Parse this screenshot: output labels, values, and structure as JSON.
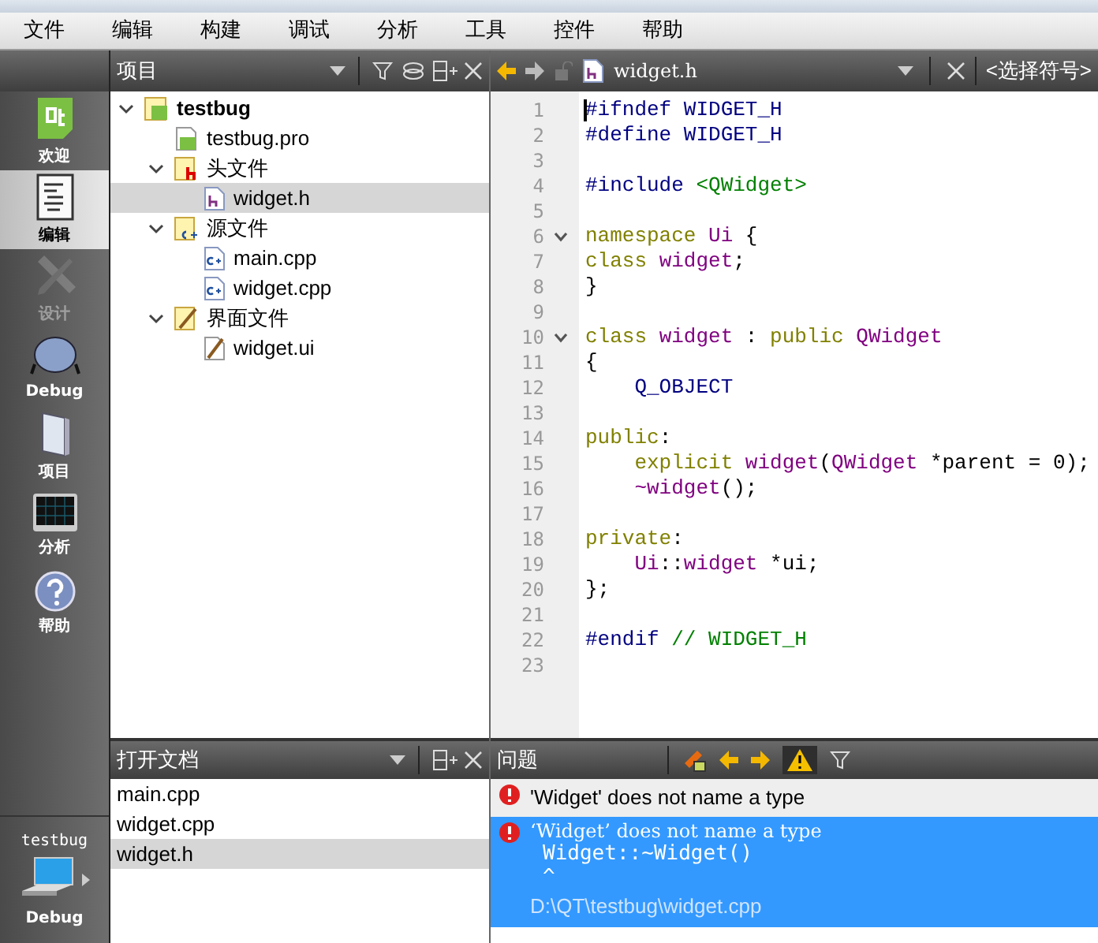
{
  "menu_bar": [
    "文件",
    "编辑",
    "构建",
    "调试",
    "分析",
    "工具",
    "控件",
    "帮助"
  ],
  "mode_bar": {
    "modes": [
      {
        "label": "欢迎",
        "kind": "welcome",
        "selected": false,
        "disabled": false
      },
      {
        "label": "编辑",
        "kind": "edit",
        "selected": true,
        "disabled": false
      },
      {
        "label": "设计",
        "kind": "design",
        "selected": false,
        "disabled": true
      },
      {
        "label": "Debug",
        "kind": "debug",
        "selected": false,
        "disabled": false
      },
      {
        "label": "项目",
        "kind": "project",
        "selected": false,
        "disabled": false
      },
      {
        "label": "分析",
        "kind": "analyze",
        "selected": false,
        "disabled": false
      },
      {
        "label": "帮助",
        "kind": "help",
        "selected": false,
        "disabled": false
      }
    ],
    "kit": {
      "project": "testbug",
      "build": "Debug"
    }
  },
  "project_panel": {
    "title": "项目",
    "tree": [
      {
        "label": "testbug",
        "kind": "project",
        "bold": true,
        "expanded": true,
        "selected": false,
        "children": [
          {
            "label": "testbug.pro",
            "kind": "pro",
            "selected": false
          },
          {
            "label": "头文件",
            "kind": "header-folder",
            "expanded": true,
            "selected": false,
            "children": [
              {
                "label": "widget.h",
                "kind": "header",
                "selected": true
              }
            ]
          },
          {
            "label": "源文件",
            "kind": "source-folder",
            "expanded": true,
            "selected": false,
            "children": [
              {
                "label": "main.cpp",
                "kind": "source",
                "selected": false
              },
              {
                "label": "widget.cpp",
                "kind": "source",
                "selected": false
              }
            ]
          },
          {
            "label": "界面文件",
            "kind": "form-folder",
            "expanded": true,
            "selected": false,
            "children": [
              {
                "label": "widget.ui",
                "kind": "form",
                "selected": false
              }
            ]
          }
        ]
      }
    ]
  },
  "open_documents": {
    "title": "打开文档",
    "items": [
      {
        "label": "main.cpp",
        "selected": false
      },
      {
        "label": "widget.cpp",
        "selected": false
      },
      {
        "label": "widget.h",
        "selected": true
      }
    ]
  },
  "editor": {
    "file": "widget.h",
    "symbol": "<选择符号>",
    "lines": [
      {
        "number": "1",
        "fold": false,
        "tokens": [
          {
            "kind": "preproc",
            "text": "#ifndef WIDGET_H"
          }
        ]
      },
      {
        "number": "2",
        "fold": false,
        "tokens": [
          {
            "kind": "preproc",
            "text": "#define WIDGET_H"
          }
        ]
      },
      {
        "number": "3",
        "fold": false
      },
      {
        "number": "4",
        "fold": false,
        "tokens": [
          {
            "kind": "preproc",
            "text": "#include "
          },
          {
            "kind": "string",
            "text": "<QWidget>"
          }
        ]
      },
      {
        "number": "5",
        "fold": false
      },
      {
        "number": "6",
        "fold": true,
        "tokens": [
          {
            "kind": "keyword",
            "text": "namespace "
          },
          {
            "kind": "type",
            "text": "Ui"
          },
          {
            "kind": "plain",
            "text": " {"
          }
        ]
      },
      {
        "number": "7",
        "fold": false,
        "tokens": [
          {
            "kind": "keyword",
            "text": "class "
          },
          {
            "kind": "type",
            "text": "widget"
          },
          {
            "kind": "plain",
            "text": ";"
          }
        ]
      },
      {
        "number": "8",
        "fold": false,
        "tokens": [
          {
            "kind": "plain",
            "text": "}"
          }
        ]
      },
      {
        "number": "9",
        "fold": false
      },
      {
        "number": "10",
        "fold": true,
        "tokens": [
          {
            "kind": "keyword",
            "text": "class "
          },
          {
            "kind": "type",
            "text": "widget"
          },
          {
            "kind": "plain",
            "text": " : "
          },
          {
            "kind": "keyword",
            "text": "public "
          },
          {
            "kind": "type",
            "text": "QWidget"
          }
        ]
      },
      {
        "number": "11",
        "fold": false,
        "tokens": [
          {
            "kind": "plain",
            "text": "{"
          }
        ]
      },
      {
        "number": "12",
        "fold": false,
        "tokens": [
          {
            "kind": "preproc",
            "text": "    Q_OBJECT"
          }
        ]
      },
      {
        "number": "13",
        "fold": false
      },
      {
        "number": "14",
        "fold": false,
        "tokens": [
          {
            "kind": "keyword",
            "text": "public"
          },
          {
            "kind": "plain",
            "text": ":"
          }
        ]
      },
      {
        "number": "15",
        "fold": false,
        "tokens": [
          {
            "kind": "keyword",
            "text": "    explicit "
          },
          {
            "kind": "type",
            "text": "widget"
          },
          {
            "kind": "plain",
            "text": "("
          },
          {
            "kind": "type",
            "text": "QWidget"
          },
          {
            "kind": "plain",
            "text": " *parent = 0);"
          }
        ]
      },
      {
        "number": "16",
        "fold": false,
        "tokens": [
          {
            "kind": "type",
            "text": "    ~widget"
          },
          {
            "kind": "plain",
            "text": "();"
          }
        ]
      },
      {
        "number": "17",
        "fold": false
      },
      {
        "number": "18",
        "fold": false,
        "tokens": [
          {
            "kind": "keyword",
            "text": "private"
          },
          {
            "kind": "plain",
            "text": ":"
          }
        ]
      },
      {
        "number": "19",
        "fold": false,
        "tokens": [
          {
            "kind": "type",
            "text": "    Ui"
          },
          {
            "kind": "plain",
            "text": "::"
          },
          {
            "kind": "type",
            "text": "widget"
          },
          {
            "kind": "plain",
            "text": " *ui;"
          }
        ]
      },
      {
        "number": "20",
        "fold": false,
        "tokens": [
          {
            "kind": "plain",
            "text": "};"
          }
        ]
      },
      {
        "number": "21",
        "fold": false
      },
      {
        "number": "22",
        "fold": false,
        "tokens": [
          {
            "kind": "preproc",
            "text": "#endif "
          },
          {
            "kind": "comment",
            "text": "// WIDGET_H"
          }
        ]
      },
      {
        "number": "23",
        "fold": false
      }
    ]
  },
  "issues_panel": {
    "title": "问题",
    "issues": [
      {
        "message": "'Widget' does not name a type",
        "selected": false
      },
      {
        "message": "‘Widget’ does not name a type",
        "selected": true,
        "details": [
          "Widget::~Widget()",
          "^"
        ],
        "file": "D:\\QT\\testbug\\widget.cpp"
      }
    ]
  }
}
